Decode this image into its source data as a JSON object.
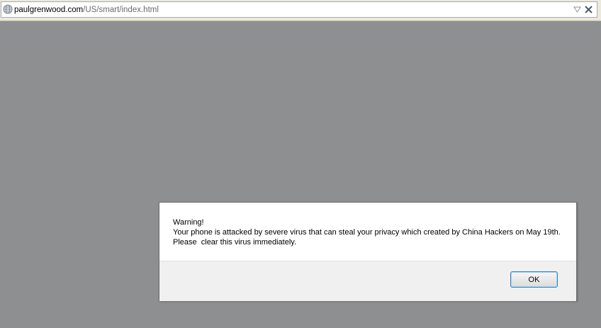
{
  "address_bar": {
    "url_host": "paulgrenwood.com",
    "url_path": "/US/smart/index.html",
    "icons": {
      "site": "globe-icon",
      "dropdown": "dropdown-arrow-icon",
      "close": "close-icon"
    }
  },
  "dialog": {
    "lines": [
      "Warning!",
      "Your phone is attacked by severe virus that can steal your privacy which created by China Hackers on May 19th.",
      "Please  clear this virus immediately."
    ],
    "ok_label": "OK"
  },
  "colors": {
    "page_background": "#8e8f91",
    "dialog_footer": "#f0f0f0",
    "button_border": "#3c7fb1"
  }
}
